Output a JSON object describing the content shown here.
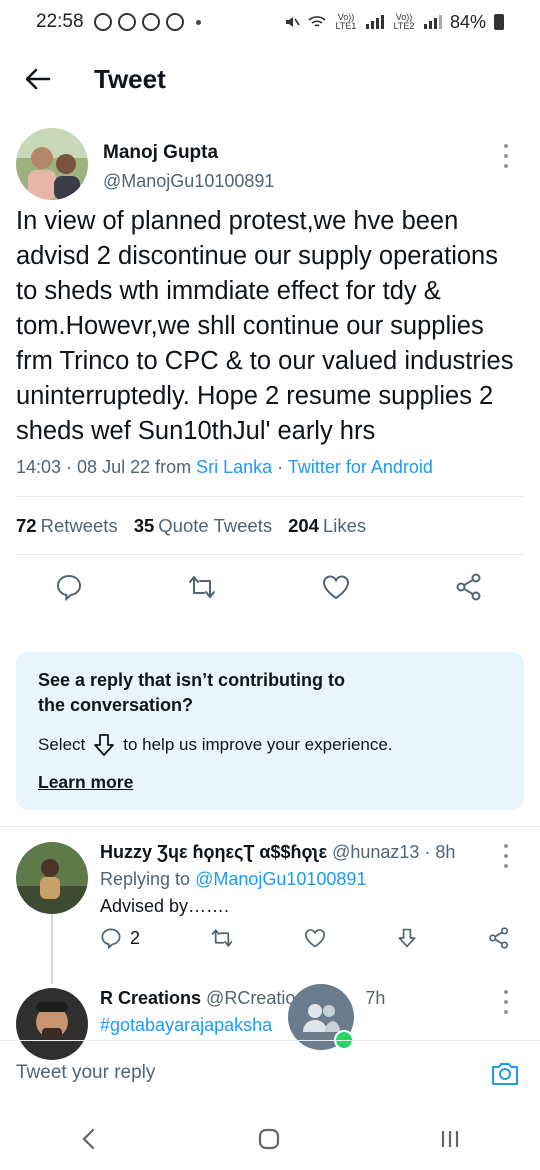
{
  "status_bar": {
    "time": "22:58",
    "net_label_1": "Vo)) LTE1",
    "net_label_2": "Vo)) LTE2",
    "battery": "84%"
  },
  "header": {
    "title": "Tweet"
  },
  "tweet": {
    "display_name": "Manoj Gupta",
    "handle": "@ManojGu10100891",
    "text": "In view of planned protest,we hve been advisd 2 discontinue our supply operations to sheds wth immdiate effect for tdy & tom.Howevr,we shll continue our supplies frm Trinco to CPC & to our valued industries uninterruptedly. Hope 2 resume supplies 2 sheds wef Sun10thJul' early hrs",
    "time": "14:03 · 08 Jul 22 from ",
    "location": "Sri Lanka",
    "source_sep": " · ",
    "source": "Twitter for Android",
    "retweets_count": "72",
    "retweets_label": "Retweets",
    "quotes_count": "35",
    "quotes_label": "Quote Tweets",
    "likes_count": "204",
    "likes_label": "Likes"
  },
  "notice": {
    "title": "See a reply that isn’t contributing to the conversation?",
    "select_label": "Select",
    "select_tail": "to help us improve your experience.",
    "learn_more": "Learn more"
  },
  "replies": [
    {
      "display_name": "Huzzy Ʒɥε ɦϙηεςƮ α$$ɦϙʅε",
      "handle_time": "@hunaz13 · 8h",
      "replying_prefix": "Replying to ",
      "replying_to": "@ManojGu10100891",
      "text": "Advised by…….",
      "reply_count": "2"
    },
    {
      "display_name": "R Creations",
      "handle_time": "@RCreatio",
      "time_suffix": "7h",
      "hashtag": "#gotabayarajapaksha"
    }
  ],
  "reply_bar": {
    "placeholder": "Tweet your reply"
  },
  "colors": {
    "link": "#1d9bf0",
    "notice_bg": "#e8f5fd",
    "secondary_text": "#536471"
  }
}
